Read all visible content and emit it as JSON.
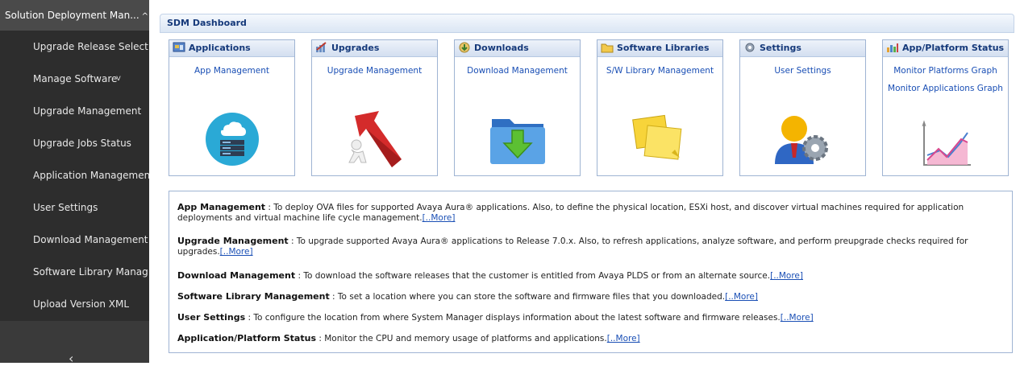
{
  "sidebar": {
    "header": "Solution Deployment Man...",
    "header_caret": "^",
    "items": [
      {
        "label": "Upgrade Release Selecti..."
      },
      {
        "label": "Manage Software",
        "chevron": "v"
      },
      {
        "label": "Upgrade Management"
      },
      {
        "label": "Upgrade Jobs Status"
      },
      {
        "label": "Application Management"
      },
      {
        "label": "User Settings"
      },
      {
        "label": "Download Management"
      },
      {
        "label": "Software Library Manag..."
      },
      {
        "label": "Upload Version XML"
      }
    ],
    "collapse_glyph": "‹"
  },
  "dashboard": {
    "title": "SDM Dashboard",
    "cards": [
      {
        "title": "Applications",
        "links": [
          "App Management"
        ],
        "icon": "applications-icon",
        "art": "cloud-server-icon"
      },
      {
        "title": "Upgrades",
        "links": [
          "Upgrade Management"
        ],
        "icon": "upgrades-icon",
        "art": "upgrade-arrow-icon"
      },
      {
        "title": "Downloads",
        "links": [
          "Download Management"
        ],
        "icon": "downloads-icon",
        "art": "download-folder-icon"
      },
      {
        "title": "Software Libraries",
        "links": [
          "S/W Library Management"
        ],
        "icon": "software-libraries-icon",
        "art": "library-notes-icon"
      },
      {
        "title": "Settings",
        "links": [
          "User Settings"
        ],
        "icon": "settings-icon",
        "art": "user-gear-icon"
      },
      {
        "title": "App/Platform Status",
        "links": [
          "Monitor Platforms Graph",
          "Monitor Applications Graph"
        ],
        "icon": "status-icon",
        "art": "graph-icon"
      }
    ],
    "descriptions": [
      {
        "term": "App Management",
        "text": " : To deploy OVA files for supported Avaya Aura® applications. Also, to define the physical location, ESXi host, and discover virtual machines required for application deployments and virtual machine life cycle management.",
        "more": "[..More]"
      },
      {
        "term": "Upgrade Management",
        "text": " : To upgrade supported Avaya Aura® applications to Release 7.0.x. Also, to refresh applications, analyze software, and perform preupgrade checks required for upgrades.",
        "more": "[..More]"
      },
      {
        "term": "Download Management",
        "text": " : To download the software releases that the customer is entitled from Avaya PLDS or from an alternate source.",
        "more": "[..More]"
      },
      {
        "term": "Software Library Management",
        "text": " : To set a location where you can store the software and firmware files that you downloaded.",
        "more": "[..More]"
      },
      {
        "term": "User Settings",
        "text": " : To configure the location from where System Manager displays information about the latest software and firmware releases.",
        "more": "[..More]"
      },
      {
        "term": "Application/Platform Status",
        "text": " : Monitor the CPU and memory usage of platforms and applications.",
        "more": "[..More]"
      }
    ]
  },
  "colors": {
    "sidebar_bg": "#2d2d2d",
    "header_text": "#15397a",
    "link": "#1a4fb5"
  }
}
